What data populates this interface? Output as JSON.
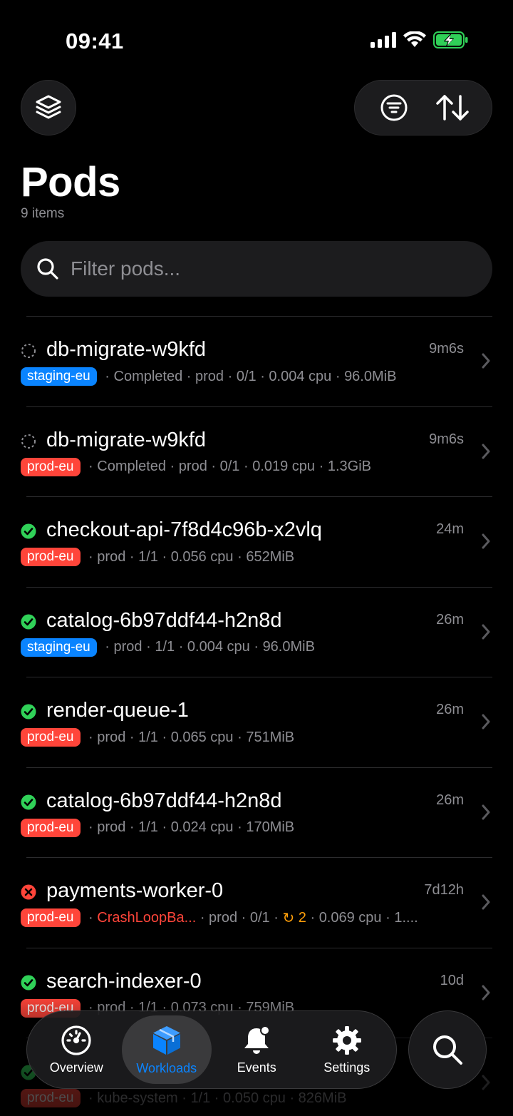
{
  "status_bar": {
    "time": "09:41"
  },
  "header": {
    "title": "Pods",
    "count": "9 items"
  },
  "search": {
    "placeholder": "Filter pods..."
  },
  "colors": {
    "accent": "#0a84ff",
    "error": "#ff453a",
    "success": "#30d158",
    "warning": "#ff9f0a"
  },
  "pods": [
    {
      "status": "completed",
      "name": "db-migrate-w9kfd",
      "age": "9m6s",
      "cluster": "staging-eu",
      "cluster_color": "blue",
      "phase": "Completed",
      "namespace": "prod",
      "ready": "0/1",
      "restarts": "",
      "cpu": "0.004 cpu",
      "mem": "96.0MiB"
    },
    {
      "status": "completed",
      "name": "db-migrate-w9kfd",
      "age": "9m6s",
      "cluster": "prod-eu",
      "cluster_color": "red",
      "phase": "Completed",
      "namespace": "prod",
      "ready": "0/1",
      "restarts": "",
      "cpu": "0.019 cpu",
      "mem": "1.3GiB"
    },
    {
      "status": "running",
      "name": "checkout-api-7f8d4c96b-x2vlq",
      "age": "24m",
      "cluster": "prod-eu",
      "cluster_color": "red",
      "phase": "",
      "namespace": "prod",
      "ready": "1/1",
      "restarts": "",
      "cpu": "0.056 cpu",
      "mem": "652MiB"
    },
    {
      "status": "running",
      "name": "catalog-6b97ddf44-h2n8d",
      "age": "26m",
      "cluster": "staging-eu",
      "cluster_color": "blue",
      "phase": "",
      "namespace": "prod",
      "ready": "1/1",
      "restarts": "",
      "cpu": "0.004 cpu",
      "mem": "96.0MiB"
    },
    {
      "status": "running",
      "name": "render-queue-1",
      "age": "26m",
      "cluster": "prod-eu",
      "cluster_color": "red",
      "phase": "",
      "namespace": "prod",
      "ready": "1/1",
      "restarts": "",
      "cpu": "0.065 cpu",
      "mem": "751MiB"
    },
    {
      "status": "running",
      "name": "catalog-6b97ddf44-h2n8d",
      "age": "26m",
      "cluster": "prod-eu",
      "cluster_color": "red",
      "phase": "",
      "namespace": "prod",
      "ready": "1/1",
      "restarts": "",
      "cpu": "0.024 cpu",
      "mem": "170MiB"
    },
    {
      "status": "failed",
      "name": "payments-worker-0",
      "age": "7d12h",
      "cluster": "prod-eu",
      "cluster_color": "red",
      "phase": "CrashLoopBa...",
      "namespace": "prod",
      "ready": "0/1",
      "restarts": "2",
      "cpu": "0.069 cpu",
      "mem": "1...."
    },
    {
      "status": "running",
      "name": "search-indexer-0",
      "age": "10d",
      "cluster": "prod-eu",
      "cluster_color": "red",
      "phase": "",
      "namespace": "prod",
      "ready": "1/1",
      "restarts": "",
      "cpu": "0.073 cpu",
      "mem": "759MiB"
    },
    {
      "status": "running",
      "name": "",
      "age": "",
      "cluster": "prod-eu",
      "cluster_color": "red",
      "phase": "",
      "namespace": "kube-system",
      "ready": "1/1",
      "restarts": "",
      "cpu": "0.050 cpu",
      "mem": "826MiB"
    }
  ],
  "tabs": [
    {
      "label": "Overview",
      "icon": "gauge-icon",
      "active": false
    },
    {
      "label": "Workloads",
      "icon": "cube-icon",
      "active": true
    },
    {
      "label": "Events",
      "icon": "bell-icon",
      "active": false
    },
    {
      "label": "Settings",
      "icon": "gear-icon",
      "active": false
    }
  ]
}
